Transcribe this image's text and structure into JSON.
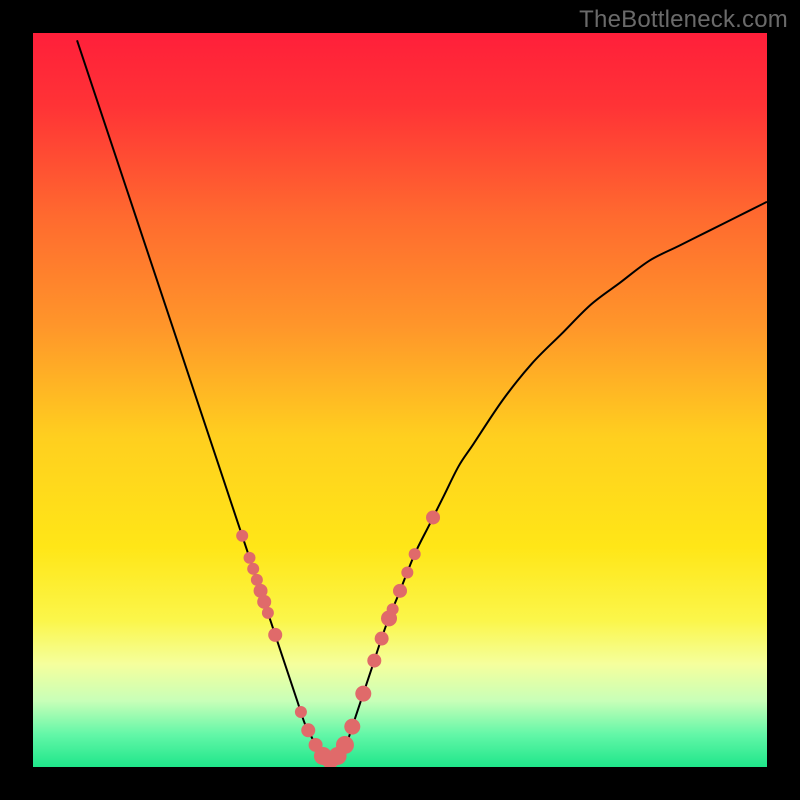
{
  "watermark": "TheBottleneck.com",
  "colors": {
    "frame_border": "#000000",
    "curve_stroke": "#000000",
    "marker_fill": "#e06a6a",
    "gradient_stops": [
      {
        "offset": 0.0,
        "color": "#ff1f3a"
      },
      {
        "offset": 0.1,
        "color": "#ff3336"
      },
      {
        "offset": 0.25,
        "color": "#ff6a2f"
      },
      {
        "offset": 0.4,
        "color": "#ff962a"
      },
      {
        "offset": 0.55,
        "color": "#ffcf1f"
      },
      {
        "offset": 0.7,
        "color": "#ffe617"
      },
      {
        "offset": 0.8,
        "color": "#fbf64a"
      },
      {
        "offset": 0.86,
        "color": "#f5ff9d"
      },
      {
        "offset": 0.91,
        "color": "#c8ffb8"
      },
      {
        "offset": 0.955,
        "color": "#64f7a8"
      },
      {
        "offset": 1.0,
        "color": "#1fe68a"
      }
    ]
  },
  "chart_data": {
    "type": "line",
    "title": "",
    "xlabel": "",
    "ylabel": "",
    "xlim": [
      0,
      100
    ],
    "ylim": [
      0,
      100
    ],
    "series": [
      {
        "name": "bottleneck-curve",
        "x": [
          6,
          8,
          10,
          12,
          14,
          16,
          18,
          20,
          22,
          24,
          26,
          28,
          30,
          32,
          34,
          35,
          36,
          37,
          38,
          39,
          40,
          41,
          42,
          43,
          44,
          46,
          48,
          50,
          52,
          54,
          56,
          58,
          60,
          64,
          68,
          72,
          76,
          80,
          84,
          88,
          92,
          96,
          100
        ],
        "values": [
          99,
          93,
          87,
          81,
          75,
          69,
          63,
          57,
          51,
          45,
          39,
          33,
          27,
          21,
          15,
          12,
          9,
          6,
          4,
          2,
          1,
          1,
          2,
          4,
          7,
          13,
          19,
          24,
          29,
          33,
          37,
          41,
          44,
          50,
          55,
          59,
          63,
          66,
          69,
          71,
          73,
          75,
          77
        ]
      }
    ],
    "markers": {
      "name": "marker-points",
      "series_ref": "bottleneck-curve",
      "x": [
        28.5,
        29.5,
        30.0,
        30.5,
        31.0,
        31.5,
        32.0,
        33.0,
        36.5,
        37.5,
        38.5,
        39.5,
        40.5,
        41.5,
        42.5,
        43.5,
        45.0,
        46.5,
        47.5,
        48.5,
        49.0,
        50.0,
        51.0,
        52.0,
        54.5
      ],
      "radius": [
        6,
        6,
        6,
        6,
        7,
        7,
        6,
        7,
        6,
        7,
        7,
        9,
        9,
        9,
        9,
        8,
        8,
        7,
        7,
        8,
        6,
        7,
        6,
        6,
        7
      ]
    }
  }
}
